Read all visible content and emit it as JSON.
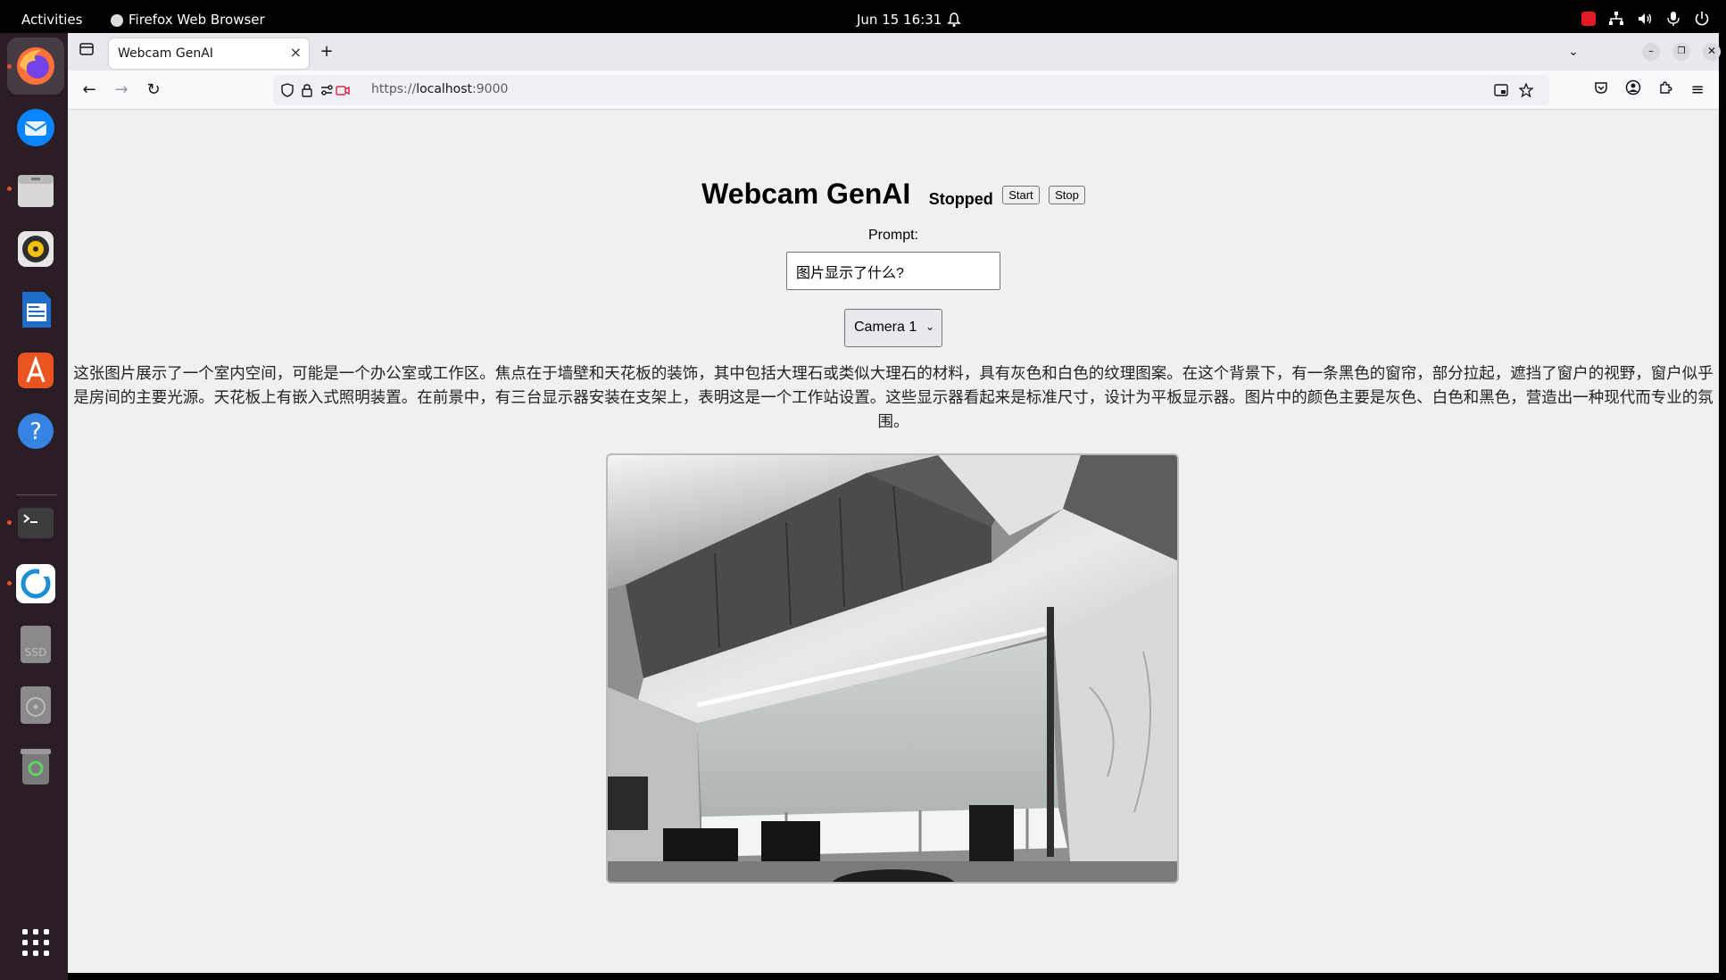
{
  "system": {
    "activities": "Activities",
    "app_name": "Firefox Web Browser",
    "clock": "Jun 15  16:31"
  },
  "browser": {
    "tab_title": "Webcam GenAI",
    "url_scheme": "https://",
    "url_host": "localhost",
    "url_port": ":9000"
  },
  "page": {
    "title": "Webcam GenAI",
    "status": "Stopped",
    "start_label": "Start",
    "stop_label": "Stop",
    "prompt_label": "Prompt:",
    "prompt_value": "图片显示了什么?",
    "camera_selected": "Camera 1",
    "answer": "这张图片展示了一个室内空间，可能是一个办公室或工作区。焦点在于墙壁和天花板的装饰，其中包括大理石或类似大理石的材料，具有灰色和白色的纹理图案。在这个背景下，有一条黑色的窗帘，部分拉起，遮挡了窗户的视野，窗户似乎是房间的主要光源。天花板上有嵌入式照明装置。在前景中，有三台显示器安装在支架上，表明这是一个工作站设置。这些显示器看起来是标准尺寸，设计为平板显示器。图片中的颜色主要是灰色、白色和黑色，营造出一种现代而专业的氛围。"
  },
  "dock": {
    "items": [
      "firefox-icon",
      "thunderbird-icon",
      "files-icon",
      "rhythmbox-icon",
      "writer-icon",
      "app-center-icon",
      "help-icon",
      "terminal-icon",
      "sync-icon",
      "ssd-drive-icon",
      "disk-drive-icon",
      "trash-icon",
      "app-grid-icon"
    ]
  },
  "colors": {
    "accent": "#e95420",
    "dock_bg": "#2b1d26",
    "page_bg": "#f0f0f0"
  }
}
